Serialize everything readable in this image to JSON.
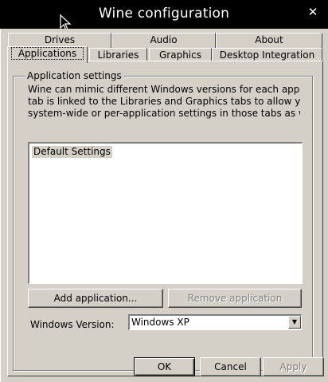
{
  "window": {
    "title": "Wine configuration",
    "close_glyph": "✕"
  },
  "tabs_back": [
    {
      "label": "Drives"
    },
    {
      "label": "Audio"
    },
    {
      "label": "About"
    }
  ],
  "tabs_front": [
    {
      "label": "Applications",
      "active": true
    },
    {
      "label": "Libraries"
    },
    {
      "label": "Graphics"
    },
    {
      "label": "Desktop Integration"
    }
  ],
  "applications": {
    "group_label": "Application settings",
    "description": [
      "Wine can mimic different Windows versions for each application.",
      "tab is linked to the Libraries and Graphics tabs to allow you to cha",
      "system-wide or per-application settings in those tabs as well."
    ],
    "list_items": [
      "Default Settings"
    ],
    "add_button": "Add application...",
    "remove_button": "Remove application",
    "version_label": "Windows Version:",
    "version_value": "Windows XP"
  },
  "footer": {
    "ok": "OK",
    "cancel": "Cancel",
    "apply": "Apply"
  }
}
